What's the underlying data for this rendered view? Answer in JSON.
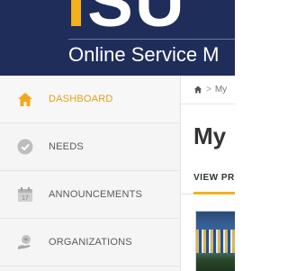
{
  "header": {
    "logo_text": "ISU",
    "logo_subtitle": "Online Service M",
    "colors": {
      "background": "#1f2d5a",
      "accent": "#f3b21b"
    }
  },
  "sidebar": {
    "items": [
      {
        "label": "DASHBOARD",
        "icon": "home-icon",
        "active": true
      },
      {
        "label": "NEEDS",
        "icon": "check-circle-icon",
        "active": false
      },
      {
        "label": "ANNOUNCEMENTS",
        "icon": "calendar-icon",
        "active": false
      },
      {
        "label": "ORGANIZATIONS",
        "icon": "globe-hand-icon",
        "active": false
      }
    ],
    "active_color": "#e0a11a"
  },
  "breadcrumb": {
    "home_icon": "home-icon",
    "separator": ">",
    "current": "My"
  },
  "main": {
    "page_title": "My",
    "tab_label": "VIEW PR",
    "tab_accent": "#f3b21b",
    "thumbnail_icon": "stadium-photo"
  }
}
